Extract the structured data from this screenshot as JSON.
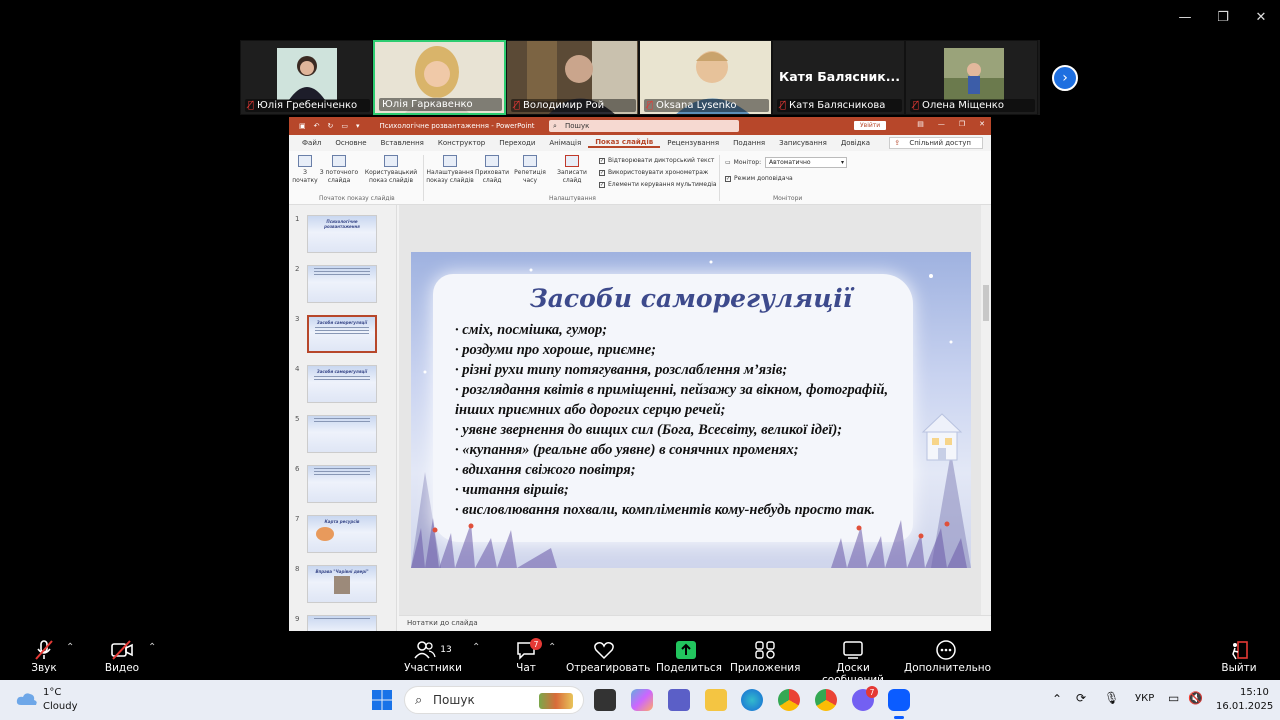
{
  "participants": [
    {
      "name": "Юлія Гребеніченко",
      "muted": true,
      "active": false
    },
    {
      "name": "Юлія Гаркавенко",
      "muted": false,
      "active": true
    },
    {
      "name": "Володимир Рой",
      "muted": true,
      "active": false
    },
    {
      "name": "Oksana Lysenko",
      "muted": true,
      "active": false
    },
    {
      "name": "Катя Баляcникова",
      "muted": true,
      "active": false,
      "display_name": "Катя  Балясник..."
    },
    {
      "name": "Олена Міщенко",
      "muted": true,
      "active": false
    }
  ],
  "ppt": {
    "doc_title": "Психологічне розвантаження  -  PowerPoint",
    "search_placeholder": "Пошук",
    "signin": "Увійти",
    "share": "Спільний доступ",
    "tabs": [
      "Файл",
      "Основне",
      "Вставлення",
      "Конструктор",
      "Переходи",
      "Анімація",
      "Показ слайдів",
      "Рецензування",
      "Подання",
      "Записування",
      "Довідка"
    ],
    "selected_tab": "Показ слайдів",
    "ribbon": {
      "from_start": "З\nпочатку",
      "from_current": "З поточного\nслайда",
      "custom_show": "Користувацький\nпоказ слайдів",
      "group_start": "Початок показу слайдів",
      "setup": "Налаштування\nпоказу слайдів",
      "hide": "Приховати\nслайд",
      "rehearse": "Репетиція\nчасу",
      "record": "Записати\nслайд",
      "chk_narration": "Відтворювати дикторський текст",
      "chk_timings": "Використовувати хронометраж",
      "chk_media": "Елементи керування мультимедіа",
      "group_setup": "Налаштування",
      "monitor_label": "Монітор:",
      "monitor_value": "Автоматично",
      "presenter_view": "Режим доповідача",
      "group_monitors": "Монітори"
    },
    "thumbnails": [
      {
        "num": "1",
        "title": "Психологічне розвантаження"
      },
      {
        "num": "2",
        "title": ""
      },
      {
        "num": "3",
        "title": "Засоби саморегуляції"
      },
      {
        "num": "4",
        "title": "Засоби саморегуляції"
      },
      {
        "num": "5",
        "title": ""
      },
      {
        "num": "6",
        "title": ""
      },
      {
        "num": "7",
        "title": "Карта ресурсів"
      },
      {
        "num": "8",
        "title": "Вправа \"Чарівні двері\""
      },
      {
        "num": "9",
        "title": ""
      }
    ],
    "current_slide": 3,
    "notes_placeholder": "Нотатки до слайда",
    "slide": {
      "title": "Засоби саморегуляції",
      "bullets": [
        "· сміх, посмішка, гумор;",
        "· роздуми про хороше, приємне;",
        "· різні рухи типу потягування, розслаблення м’язів;",
        "· розглядання квітів в приміщенні, пейзажу за вікном, фотографій,",
        "інших приємних або дорогих серцю речей;",
        "· уявне звернення до вищих сил (Бога, Всесвіту, великої ідеї);",
        "· «купання» (реальне або уявне) в сонячних променях;",
        "· вдихання свіжого повітря;",
        "· читання віршів;",
        "· висловлювання похвали, компліментів кому-небудь просто так."
      ]
    }
  },
  "zoom_bar": {
    "audio": "Звук",
    "video": "Видео",
    "participants": "Участники",
    "participants_count": "13",
    "chat": "Чат",
    "chat_badge": "7",
    "react": "Отреагировать",
    "share": "Поделиться",
    "apps": "Приложения",
    "whiteboards": "Доски сообщений",
    "more": "Дополнительно",
    "leave": "Выйти"
  },
  "taskbar": {
    "weather_temp": "1°C",
    "weather_desc": "Cloudy",
    "search": "Пошук",
    "lang": "УКР",
    "time": "15:10",
    "date": "16.01.2025",
    "viber_badge": "7"
  },
  "colors": {
    "ppt_accent": "#b7472a",
    "zoom_active": "#2ecc71",
    "zoom_blue": "#1e6fe0",
    "mute_red": "#e53935"
  }
}
